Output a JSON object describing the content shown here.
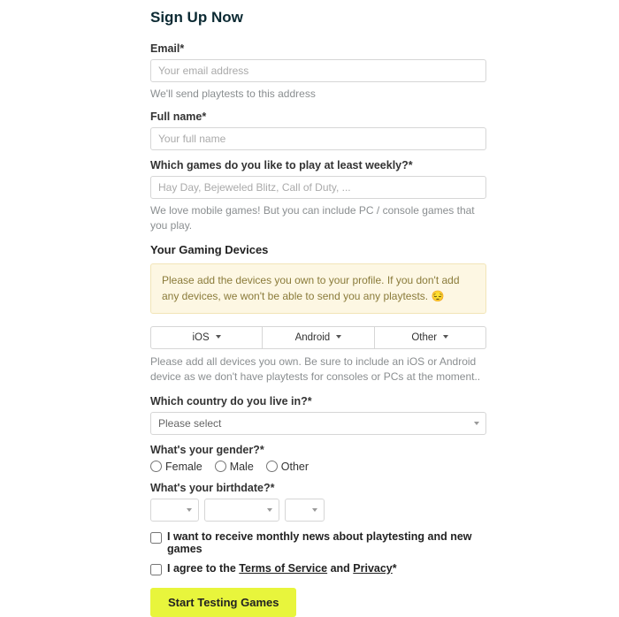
{
  "heading": "Sign Up Now",
  "email": {
    "label": "Email*",
    "placeholder": "Your email address",
    "helper": "We'll send playtests to this address"
  },
  "fullname": {
    "label": "Full name*",
    "placeholder": "Your full name"
  },
  "games": {
    "label": "Which games do you like to play at least weekly?*",
    "placeholder": "Hay Day, Bejeweled Blitz, Call of Duty, ...",
    "helper": "We love mobile games! But you can include PC / console games that you play."
  },
  "devices": {
    "heading": "Your Gaming Devices",
    "notice": "Please add the devices you own to your profile. If you don't add any devices, we won't be able to send you any playtests.",
    "emoji": "😔",
    "ios": "iOS",
    "android": "Android",
    "other": "Other",
    "helper": "Please add all devices you own. Be sure to include an iOS or Android device as we don't have playtests for consoles or PCs at the moment.."
  },
  "country": {
    "label": "Which country do you live in?*",
    "placeholder": "Please select"
  },
  "gender": {
    "label": "What's your gender?*",
    "female": "Female",
    "male": "Male",
    "other": "Other"
  },
  "birthdate": {
    "label": "What's your birthdate?*"
  },
  "newsletter": "I want to receive monthly news about playtesting and new games",
  "agree": {
    "prefix": "I agree to the ",
    "tos": "Terms of Service",
    "mid": " and ",
    "privacy": "Privacy",
    "suffix": "*"
  },
  "submit": "Start Testing Games"
}
